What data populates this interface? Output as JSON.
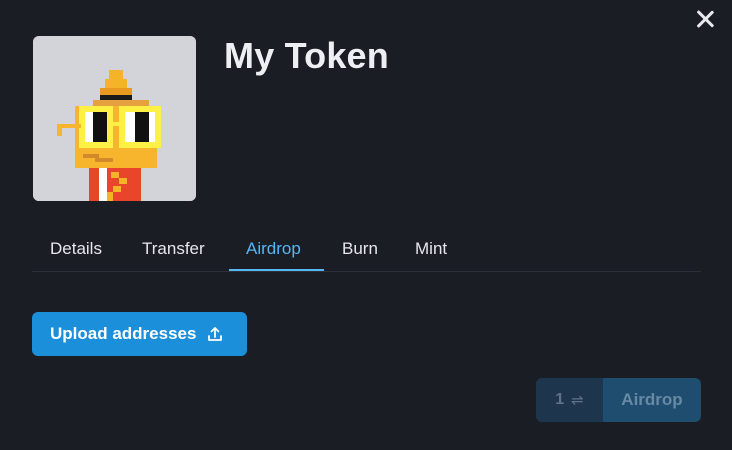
{
  "token": {
    "name": "My Token",
    "image_icon": "pixel-character-avatar"
  },
  "tabs": [
    {
      "label": "Details",
      "active": false
    },
    {
      "label": "Transfer",
      "active": false
    },
    {
      "label": "Airdrop",
      "active": true
    },
    {
      "label": "Burn",
      "active": false
    },
    {
      "label": "Mint",
      "active": false
    }
  ],
  "actions": {
    "upload_label": "Upload addresses",
    "upload_icon": "upload-icon",
    "count": "1",
    "swap_glyph": "⇌",
    "airdrop_label": "Airdrop"
  },
  "icons": {
    "close": "close-icon"
  },
  "colors": {
    "background": "#1b1d24",
    "accent": "#55b7f3",
    "primary_button": "#1b8fd9",
    "disabled_button": "#1f4d6f"
  }
}
